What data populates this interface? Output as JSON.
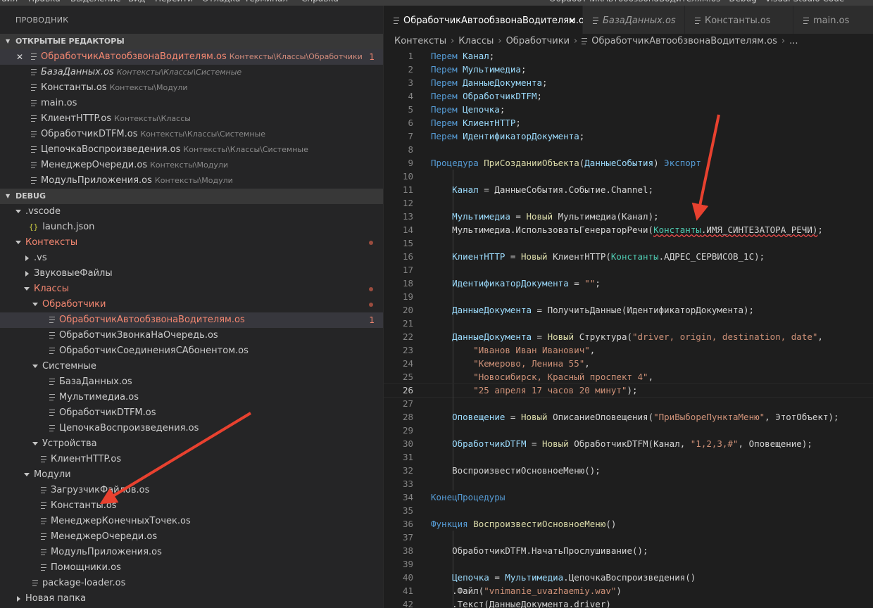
{
  "menubar": [
    "Файл",
    "Правка",
    "Выделение",
    "Вид",
    "Перейти",
    "Отладка",
    "Терминал",
    "Справка"
  ],
  "window_title": "ОбработчикАвтообзвонаВодителям.os - Debug - Visual Studio Code",
  "sidebar": {
    "title": "ПРОВОДНИК",
    "open_editors_header": "ОТКРЫТЫЕ РЕДАКТОРЫ",
    "open_editors": [
      {
        "name": "ОбработчикАвтообзвонаВодителям.os",
        "path": "Контексты\\Классы\\Обработчики",
        "badge": "1"
      },
      {
        "name": "БазаДанных.os",
        "path": "Контексты\\Классы\\Системные",
        "badge": ""
      },
      {
        "name": "Константы.os",
        "path": "Контексты\\Модули",
        "badge": ""
      },
      {
        "name": "main.os",
        "path": "",
        "badge": ""
      },
      {
        "name": "КлиентHTTP.os",
        "path": "Контексты\\Классы",
        "badge": ""
      },
      {
        "name": "ОбработчикDTFM.os",
        "path": "Контексты\\Классы\\Системные",
        "badge": ""
      },
      {
        "name": "ЦепочкаВоспроизведения.os",
        "path": "Контексты\\Классы\\Системные",
        "badge": ""
      },
      {
        "name": "МенеджерОчереди.os",
        "path": "Контексты\\Модули",
        "badge": ""
      },
      {
        "name": "МодульПриложения.os",
        "path": "Контексты\\Модули",
        "badge": ""
      }
    ],
    "debug_header": "DEBUG",
    "tree": [
      {
        "label": ".vscode",
        "kind": "folder-open",
        "depth": 0,
        "state": ""
      },
      {
        "label": "launch.json",
        "kind": "json",
        "depth": 1,
        "state": ""
      },
      {
        "label": "Контексты",
        "kind": "folder-open",
        "depth": 0,
        "state": "modified"
      },
      {
        "label": ".vs",
        "kind": "folder-closed",
        "depth": 1,
        "state": ""
      },
      {
        "label": "ЗвуковыеФайлы",
        "kind": "folder-closed",
        "depth": 1,
        "state": ""
      },
      {
        "label": "Классы",
        "kind": "folder-open",
        "depth": 1,
        "state": "modified"
      },
      {
        "label": "Обработчики",
        "kind": "folder-open",
        "depth": 2,
        "state": "modified"
      },
      {
        "label": "ОбработчикАвтообзвонаВодителям.os",
        "kind": "file",
        "depth": 3,
        "state": "selected",
        "badge": "1"
      },
      {
        "label": "ОбработчикЗвонкаНаОчередь.os",
        "kind": "file",
        "depth": 3,
        "state": ""
      },
      {
        "label": "ОбработчикСоединенияСАбонентом.os",
        "kind": "file",
        "depth": 3,
        "state": ""
      },
      {
        "label": "Системные",
        "kind": "folder-open",
        "depth": 2,
        "state": ""
      },
      {
        "label": "БазаДанных.os",
        "kind": "file",
        "depth": 3,
        "state": ""
      },
      {
        "label": "Мультимедиа.os",
        "kind": "file",
        "depth": 3,
        "state": ""
      },
      {
        "label": "ОбработчикDTFM.os",
        "kind": "file",
        "depth": 3,
        "state": ""
      },
      {
        "label": "ЦепочкаВоспроизведения.os",
        "kind": "file",
        "depth": 3,
        "state": ""
      },
      {
        "label": "Устройства",
        "kind": "folder-open",
        "depth": 2,
        "state": ""
      },
      {
        "label": "КлиентHTTP.os",
        "kind": "file",
        "depth": 2,
        "state": ""
      },
      {
        "label": "Модули",
        "kind": "folder-open",
        "depth": 1,
        "state": ""
      },
      {
        "label": "ЗагрузчикФайлов.os",
        "kind": "file",
        "depth": 2,
        "state": ""
      },
      {
        "label": "Константы.os",
        "kind": "file",
        "depth": 2,
        "state": ""
      },
      {
        "label": "МенеджерКонечныхТочек.os",
        "kind": "file",
        "depth": 2,
        "state": ""
      },
      {
        "label": "МенеджерОчереди.os",
        "kind": "file",
        "depth": 2,
        "state": ""
      },
      {
        "label": "МодульПриложения.os",
        "kind": "file",
        "depth": 2,
        "state": ""
      },
      {
        "label": "Помощники.os",
        "kind": "file",
        "depth": 2,
        "state": ""
      },
      {
        "label": "package-loader.os",
        "kind": "file",
        "depth": 1,
        "state": ""
      },
      {
        "label": "Новая папка",
        "kind": "folder-closed",
        "depth": 0,
        "state": ""
      }
    ]
  },
  "tabs": [
    {
      "label": "ОбработчикАвтообзвонаВодителям.os",
      "active": true,
      "italic": false
    },
    {
      "label": "БазаДанных.os",
      "active": false,
      "italic": true
    },
    {
      "label": "Константы.os",
      "active": false,
      "italic": false
    },
    {
      "label": "main.os",
      "active": false,
      "italic": false
    }
  ],
  "breadcrumb": [
    "Контексты",
    "Классы",
    "Обработчики",
    "ОбработчикАвтообзвонаВодителям.os",
    "..."
  ],
  "editor": {
    "current_line": 26,
    "lines": [
      {
        "n": 1,
        "tokens": [
          [
            "kw",
            "Перем "
          ],
          [
            "var",
            "Канал"
          ],
          [
            "p",
            ";"
          ]
        ]
      },
      {
        "n": 2,
        "tokens": [
          [
            "kw",
            "Перем "
          ],
          [
            "var",
            "Мультимедиа"
          ],
          [
            "p",
            ";"
          ]
        ]
      },
      {
        "n": 3,
        "tokens": [
          [
            "kw",
            "Перем "
          ],
          [
            "var",
            "ДанныеДокумента"
          ],
          [
            "p",
            ";"
          ]
        ]
      },
      {
        "n": 4,
        "tokens": [
          [
            "kw",
            "Перем "
          ],
          [
            "var",
            "ОбработчикDTFM"
          ],
          [
            "p",
            ";"
          ]
        ]
      },
      {
        "n": 5,
        "tokens": [
          [
            "kw",
            "Перем "
          ],
          [
            "var",
            "Цепочка"
          ],
          [
            "p",
            ";"
          ]
        ]
      },
      {
        "n": 6,
        "tokens": [
          [
            "kw",
            "Перем "
          ],
          [
            "var",
            "КлиентHTTP"
          ],
          [
            "p",
            ";"
          ]
        ]
      },
      {
        "n": 7,
        "tokens": [
          [
            "kw",
            "Перем "
          ],
          [
            "var",
            "ИдентификаторДокумента"
          ],
          [
            "p",
            ";"
          ]
        ]
      },
      {
        "n": 8,
        "tokens": []
      },
      {
        "n": 9,
        "tokens": [
          [
            "kw",
            "Процедура "
          ],
          [
            "fn",
            "ПриСозданииОбъекта"
          ],
          [
            "p",
            "("
          ],
          [
            "var",
            "ДанныеСобытия"
          ],
          [
            "p",
            ") "
          ],
          [
            "kw",
            "Экспорт"
          ]
        ]
      },
      {
        "n": 10,
        "tokens": [],
        "guide": true
      },
      {
        "n": 11,
        "tokens": [
          [
            "p",
            "    "
          ],
          [
            "var",
            "Канал"
          ],
          [
            "p",
            " = ДанныеСобытия.Событие.Channel;"
          ]
        ],
        "guide": true
      },
      {
        "n": 12,
        "tokens": [],
        "guide": true
      },
      {
        "n": 13,
        "tokens": [
          [
            "p",
            "    "
          ],
          [
            "var",
            "Мультимедиа"
          ],
          [
            "p",
            " = "
          ],
          [
            "fn",
            "Новый "
          ],
          [
            "p",
            "Мультимедиа(Канал);"
          ]
        ],
        "guide": true
      },
      {
        "n": 14,
        "tokens": [
          [
            "p",
            "    Мультимедиа.ИспользоватьГенераторРечи("
          ],
          [
            "cls-sq",
            "Константы"
          ],
          [
            "sq",
            ".ИМЯ_СИНТЕЗАТОРА_РЕЧИ)"
          ],
          [
            "p",
            ";"
          ]
        ],
        "guide": true
      },
      {
        "n": 15,
        "tokens": [],
        "guide": true
      },
      {
        "n": 16,
        "tokens": [
          [
            "p",
            "    "
          ],
          [
            "var",
            "КлиентHTTP"
          ],
          [
            "p",
            " = "
          ],
          [
            "fn",
            "Новый "
          ],
          [
            "p",
            "КлиентHTTP("
          ],
          [
            "cls",
            "Константы"
          ],
          [
            "p",
            ".АДРЕС_СЕРВИСОВ_1С);"
          ]
        ],
        "guide": true
      },
      {
        "n": 17,
        "tokens": [],
        "guide": true
      },
      {
        "n": 18,
        "tokens": [
          [
            "p",
            "    "
          ],
          [
            "var",
            "ИдентификаторДокумента"
          ],
          [
            "p",
            " = "
          ],
          [
            "str",
            "\"\""
          ],
          [
            "p",
            ";"
          ]
        ],
        "guide": true
      },
      {
        "n": 19,
        "tokens": [],
        "guide": true
      },
      {
        "n": 20,
        "tokens": [
          [
            "p",
            "    "
          ],
          [
            "var",
            "ДанныеДокумента"
          ],
          [
            "p",
            " = ПолучитьДанные(ИдентификаторДокумента);"
          ]
        ],
        "guide": true
      },
      {
        "n": 21,
        "tokens": [],
        "guide": true
      },
      {
        "n": 22,
        "tokens": [
          [
            "p",
            "    "
          ],
          [
            "var",
            "ДанныеДокумента"
          ],
          [
            "p",
            " = "
          ],
          [
            "fn",
            "Новый "
          ],
          [
            "p",
            "Структура("
          ],
          [
            "str",
            "\"driver, origin, destination, date\""
          ],
          [
            "p",
            ","
          ]
        ],
        "guide": true
      },
      {
        "n": 23,
        "tokens": [
          [
            "p",
            "        "
          ],
          [
            "str",
            "\"Иванов Иван Иванович\""
          ],
          [
            "p",
            ","
          ]
        ],
        "guide": true
      },
      {
        "n": 24,
        "tokens": [
          [
            "p",
            "        "
          ],
          [
            "str",
            "\"Кемерово, Ленина 55\""
          ],
          [
            "p",
            ","
          ]
        ],
        "guide": true
      },
      {
        "n": 25,
        "tokens": [
          [
            "p",
            "        "
          ],
          [
            "str",
            "\"Новосибирск, Красный проспект 4\""
          ],
          [
            "p",
            ","
          ]
        ],
        "guide": true
      },
      {
        "n": 26,
        "tokens": [
          [
            "p",
            "        "
          ],
          [
            "str",
            "\"25 апреля 17 часов 20 минут\""
          ],
          [
            "p",
            ");"
          ]
        ],
        "guide": true
      },
      {
        "n": 27,
        "tokens": [],
        "guide": true
      },
      {
        "n": 28,
        "tokens": [
          [
            "p",
            "    "
          ],
          [
            "var",
            "Оповещение"
          ],
          [
            "p",
            " = "
          ],
          [
            "fn",
            "Новый "
          ],
          [
            "p",
            "ОписаниеОповещения("
          ],
          [
            "str",
            "\"ПриВыбореПунктаМеню\""
          ],
          [
            "p",
            ", ЭтотОбъект);"
          ]
        ],
        "guide": true
      },
      {
        "n": 29,
        "tokens": [],
        "guide": true
      },
      {
        "n": 30,
        "tokens": [
          [
            "p",
            "    "
          ],
          [
            "var",
            "ОбработчикDTFM"
          ],
          [
            "p",
            " = "
          ],
          [
            "fn",
            "Новый "
          ],
          [
            "p",
            "ОбработчикDTFM(Канал, "
          ],
          [
            "str",
            "\"1,2,3,#\""
          ],
          [
            "p",
            ", Оповещение);"
          ]
        ],
        "guide": true
      },
      {
        "n": 31,
        "tokens": [],
        "guide": true
      },
      {
        "n": 32,
        "tokens": [
          [
            "p",
            "    ВоспроизвестиОсновноеМеню();"
          ]
        ],
        "guide": true
      },
      {
        "n": 33,
        "tokens": [],
        "guide": true
      },
      {
        "n": 34,
        "tokens": [
          [
            "kw",
            "КонецПроцедуры"
          ]
        ]
      },
      {
        "n": 35,
        "tokens": []
      },
      {
        "n": 36,
        "tokens": [
          [
            "kw",
            "Функция "
          ],
          [
            "fn",
            "ВоспроизвестиОсновноеМеню"
          ],
          [
            "p",
            "()"
          ]
        ]
      },
      {
        "n": 37,
        "tokens": [],
        "guide": true
      },
      {
        "n": 38,
        "tokens": [
          [
            "p",
            "    ОбработчикDTFM.НачатьПрослушивание();"
          ]
        ],
        "guide": true
      },
      {
        "n": 39,
        "tokens": [],
        "guide": true
      },
      {
        "n": 40,
        "tokens": [
          [
            "p",
            "    "
          ],
          [
            "var",
            "Цепочка"
          ],
          [
            "p",
            " = "
          ],
          [
            "var",
            "Мультимедиа"
          ],
          [
            "p",
            ".ЦепочкаВоспроизведения()"
          ]
        ],
        "guide": true
      },
      {
        "n": 41,
        "tokens": [
          [
            "p",
            "    .Файл("
          ],
          [
            "str",
            "\"vnimanie_uvazhaemiy.wav\""
          ],
          [
            "p",
            ")"
          ]
        ],
        "guide": true
      },
      {
        "n": 42,
        "tokens": [
          [
            "p",
            "    .Текст(ДанныеДокумента.driver)"
          ]
        ],
        "guide": true
      }
    ]
  },
  "colors": {
    "accent_red": "#e8412f",
    "modified": "#f48771",
    "keyword": "#569cd6",
    "string": "#ce9178"
  }
}
